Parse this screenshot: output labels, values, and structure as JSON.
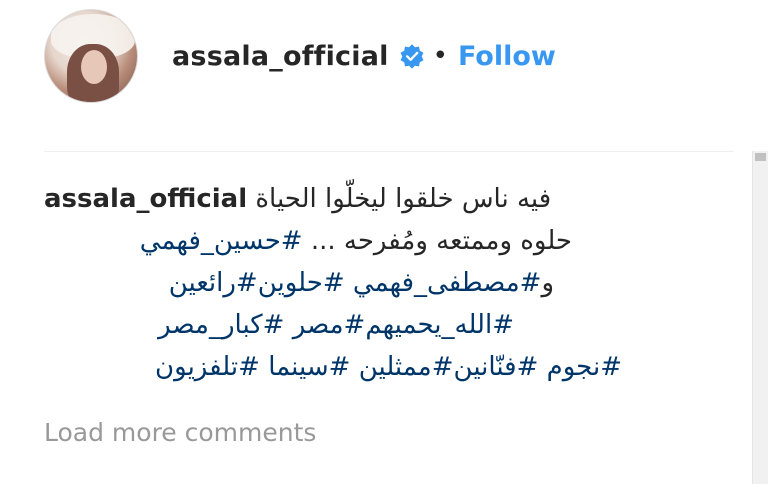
{
  "header": {
    "username": "assala_official",
    "separator": "•",
    "follow_label": "Follow",
    "verified_badge_color": "#3897f0"
  },
  "caption": {
    "username": "assala_official",
    "text_line1": "فيه ناس خلقوا ليخلّوا الحياة",
    "text_line2": "حلوه وممتعه ومُفرحه ...",
    "hashtags": [
      "#حسين_فهمي",
      "#مصطفى_فهمي",
      "#حلوين",
      "#رائعين",
      "#الله_يحميهم",
      "#مصر",
      "#كبار_مصر",
      "#نجوم",
      "#فنّانين",
      "#ممثلين",
      "#سينما",
      "#تلفزيون"
    ],
    "line3_prefix": "و"
  },
  "load_more": "Load more comments",
  "colors": {
    "link_blue": "#3897f0",
    "hashtag": "#003569",
    "muted": "#999999",
    "text": "#262626"
  }
}
